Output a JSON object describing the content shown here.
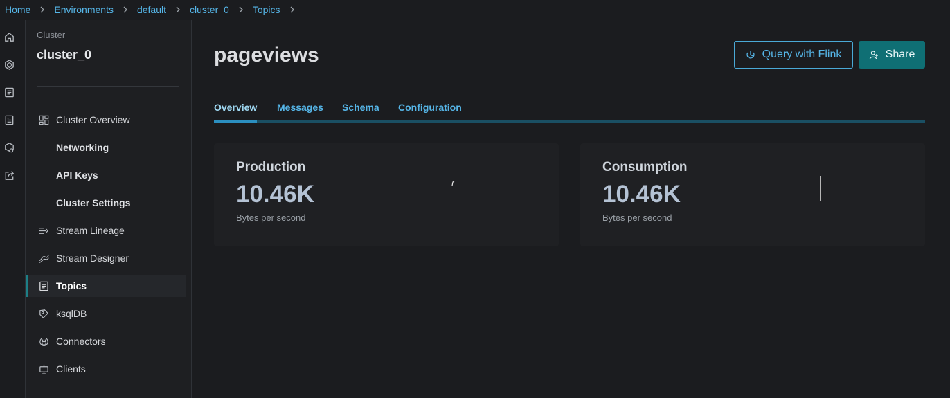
{
  "breadcrumb": [
    {
      "label": "Home"
    },
    {
      "label": "Environments"
    },
    {
      "label": "default"
    },
    {
      "label": "cluster_0"
    },
    {
      "label": "Topics"
    }
  ],
  "rail_icons": [
    "home-icon",
    "environments-icon",
    "documents-icon",
    "notes-icon",
    "data-portal-icon",
    "share-out-icon"
  ],
  "sidebar": {
    "label": "Cluster",
    "title": "cluster_0",
    "items": [
      {
        "label": "Cluster Overview",
        "icon": "dashboard-icon"
      },
      {
        "label": "Networking"
      },
      {
        "label": "API Keys"
      },
      {
        "label": "Cluster Settings"
      },
      {
        "label": "Stream Lineage",
        "icon": "lineage-icon"
      },
      {
        "label": "Stream Designer",
        "icon": "designer-icon"
      },
      {
        "label": "Topics",
        "icon": "topics-icon",
        "active": true
      },
      {
        "label": "ksqlDB",
        "icon": "ksqldb-icon"
      },
      {
        "label": "Connectors",
        "icon": "connectors-icon"
      },
      {
        "label": "Clients",
        "icon": "clients-icon"
      }
    ]
  },
  "main": {
    "title": "pageviews",
    "query_button": "Query with Flink",
    "share_button": "Share",
    "tabs": [
      {
        "label": "Overview",
        "active": true
      },
      {
        "label": "Messages"
      },
      {
        "label": "Schema"
      },
      {
        "label": "Configuration"
      }
    ],
    "cards": [
      {
        "title": "Production",
        "value": "10.46K",
        "unit": "Bytes per second"
      },
      {
        "title": "Consumption",
        "value": "10.46K",
        "unit": "Bytes per second"
      }
    ]
  },
  "colors": {
    "accent_link": "#56b6e8",
    "primary_button": "#0f6f74",
    "background": "#1b1c1f"
  }
}
